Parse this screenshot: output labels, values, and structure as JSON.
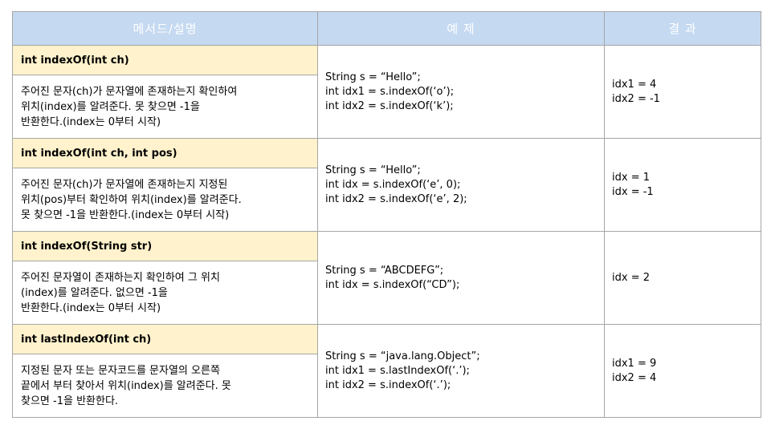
{
  "headers": [
    "메서드/설명",
    "예 제",
    "결 과"
  ],
  "rows": [
    {
      "method": "int indexOf(int ch)",
      "description": [
        "주어진 문자(ch)가 문자열에 존재하는지 확인하여",
        "위치(index)를 알려준다. 못 찾으면 -1을",
        "반환한다.(index는 0부터 시작)"
      ],
      "example": [
        "String s = “Hello”;",
        "int idx1 = s.indexOf(‘o’);",
        "int idx2 = s.indexOf(‘k’);"
      ],
      "result": [
        "idx1 = 4",
        "idx2 = -1"
      ]
    },
    {
      "method": "int indexOf(int ch, int pos)",
      "description": [
        "주어진 문자(ch)가 문자열에 존재하는지 지정된",
        "위치(pos)부터 확인하여 위치(index)를 알려준다.",
        "못 찾으면 -1을 반환한다.(index는 0부터 시작)"
      ],
      "example": [
        "String s = “Hello”;",
        "int idx = s.indexOf(‘e’, 0);",
        "int idx2 = s.indexOf(‘e’, 2);"
      ],
      "result": [
        "idx = 1",
        "idx = -1"
      ]
    },
    {
      "method": "int indexOf(String str)",
      "description": [
        "주어진 문자열이 존재하는지 확인하여 그 위치",
        "(index)를 알려준다. 없으면 -1을",
        "반환한다.(index는 0부터 시작)"
      ],
      "example": [
        "String s = “ABCDEFG”;",
        "int idx = s.indexOf(“CD”);"
      ],
      "result": [
        "idx = 2"
      ]
    },
    {
      "method": "int lastIndexOf(int ch)",
      "description": [
        "지정된 문자 또는 문자코드를 문자열의 오른쪽",
        "끝에서 부터 찾아서 위치(index)를 알려준다. 못",
        "찾으면 -1을 반환한다."
      ],
      "example": [
        "String s = “java.lang.Object”;",
        "int idx1 = s.lastIndexOf(‘.’);",
        "int idx2 = s.indexOf(‘.’);"
      ],
      "result": [
        "idx1 = 9",
        "idx2 = 4"
      ]
    }
  ]
}
